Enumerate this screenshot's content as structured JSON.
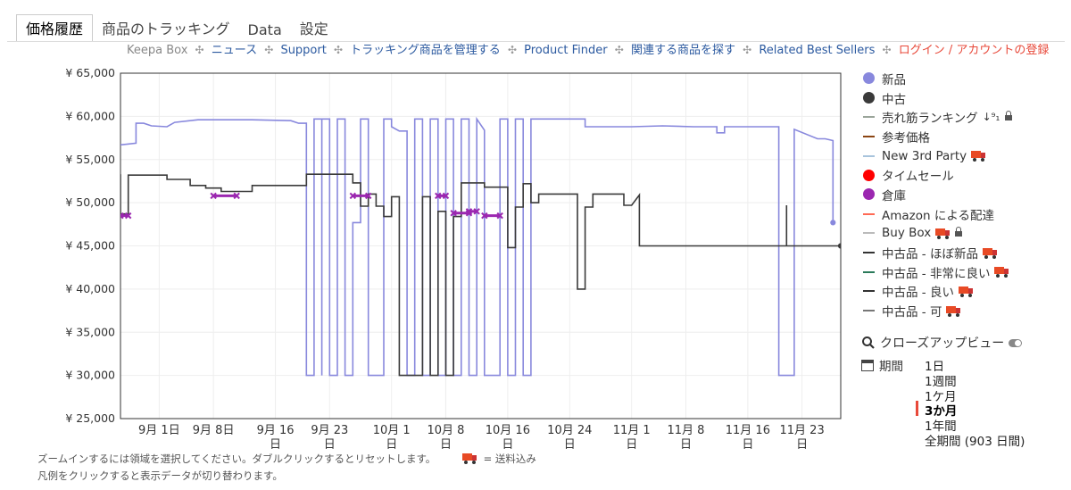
{
  "tabs": [
    {
      "label": "価格履歴",
      "active": true
    },
    {
      "label": "商品のトラッキング",
      "active": false
    },
    {
      "label": "Data",
      "active": false
    },
    {
      "label": "設定",
      "active": false
    }
  ],
  "links": {
    "keepa_box": "Keepa Box",
    "separator": "✣",
    "items": [
      "ニュース",
      "Support",
      "トラッキング商品を管理する",
      "Product Finder",
      "関連する商品を探す",
      "Related Best Sellers"
    ],
    "login": "ログイン / アカウントの登録"
  },
  "colors": {
    "new": "#8888dd",
    "used": "#3a3a3a",
    "warehouse": "#9b27b0",
    "lightning": "#ff0000",
    "amazon": "#ff6a55",
    "list": "#8b4513",
    "third": "#a8c4dc",
    "buybox": "#bbbbbb",
    "very_good": "#2a7a5a",
    "grid": "#eeeeee"
  },
  "legend": [
    {
      "label": "新品",
      "kind": "dot",
      "color": "#8888dd"
    },
    {
      "label": "中古",
      "kind": "dot",
      "color": "#3a3a3a"
    },
    {
      "label": "売れ筋ランキング",
      "kind": "dash",
      "color": "#9aa59a",
      "sort_icon": "↓⁹₁",
      "lock": true
    },
    {
      "label": "参考価格",
      "kind": "dash",
      "color": "#8b4513"
    },
    {
      "label": "New 3rd Party",
      "kind": "dash",
      "color": "#a8c4dc",
      "truck": true
    },
    {
      "label": "タイムセール",
      "kind": "dot",
      "color": "#ff0000"
    },
    {
      "label": "倉庫",
      "kind": "dot",
      "color": "#9b27b0"
    },
    {
      "label": "Amazon による配達",
      "kind": "dash",
      "color": "#ff6a55"
    },
    {
      "label": "Buy Box",
      "kind": "dash",
      "color": "#bbbbbb",
      "truck": true,
      "lock": true
    },
    {
      "label": "中古品 - ほぼ新品",
      "kind": "dash",
      "color": "#333333",
      "truck": true
    },
    {
      "label": "中古品 - 非常に良い",
      "kind": "dash",
      "color": "#2a7a5a",
      "truck": true
    },
    {
      "label": "中古品 - 良い",
      "kind": "dash",
      "color": "#333333",
      "truck": true
    },
    {
      "label": "中古品 - 可",
      "kind": "dash",
      "color": "#777777",
      "truck": true
    }
  ],
  "zoom": {
    "label": "クローズアップビュー"
  },
  "period": {
    "label": "期間",
    "options": [
      "1日",
      "1週間",
      "1ケ月",
      "3か月",
      "1年間",
      "全期間 (903 日間)"
    ],
    "selected": "3か月"
  },
  "footer": {
    "line1": "ズームインするには領域を選択してください。ダブルクリックするとリセットします。",
    "truck_note": "= 送料込み",
    "line2": "凡例をクリックすると表示データが切り替わります。"
  },
  "chart_data": {
    "type": "line",
    "x_unit": "date",
    "y_unit": "JPY",
    "xlim": [
      "2024-08-27",
      "2024-11-28"
    ],
    "ylim": [
      25000,
      65000
    ],
    "y_ticks": [
      25000,
      30000,
      35000,
      40000,
      45000,
      50000,
      55000,
      60000,
      65000
    ],
    "y_tick_labels": [
      "¥ 25,000",
      "¥ 30,000",
      "¥ 35,000",
      "¥ 40,000",
      "¥ 45,000",
      "¥ 50,000",
      "¥ 55,000",
      "¥ 60,000",
      "¥ 65,000"
    ],
    "x_ticks": [
      {
        "date": "2024-09-01",
        "l1": "9月 1日",
        "l2": ""
      },
      {
        "date": "2024-09-08",
        "l1": "9月 8日",
        "l2": ""
      },
      {
        "date": "2024-09-16",
        "l1": "9月 16",
        "l2": "日"
      },
      {
        "date": "2024-09-23",
        "l1": "9月 23",
        "l2": "日"
      },
      {
        "date": "2024-10-01",
        "l1": "10月 1",
        "l2": "日"
      },
      {
        "date": "2024-10-08",
        "l1": "10月 8",
        "l2": "日"
      },
      {
        "date": "2024-10-16",
        "l1": "10月 16",
        "l2": "日"
      },
      {
        "date": "2024-10-24",
        "l1": "10月 24",
        "l2": "日"
      },
      {
        "date": "2024-11-01",
        "l1": "11月 1",
        "l2": "日"
      },
      {
        "date": "2024-11-08",
        "l1": "11月 8",
        "l2": "日"
      },
      {
        "date": "2024-11-16",
        "l1": "11月 16",
        "l2": "日"
      },
      {
        "date": "2024-11-23",
        "l1": "11月 23",
        "l2": "日"
      }
    ],
    "grid": true,
    "legend_position": "right",
    "series": [
      {
        "name": "新品",
        "color": "#8888dd",
        "points": [
          [
            "2024-08-27",
            56700
          ],
          [
            "2024-08-29",
            56900
          ],
          [
            "2024-08-29",
            59200
          ],
          [
            "2024-08-30",
            59200
          ],
          [
            "2024-08-31",
            58900
          ],
          [
            "2024-09-02",
            58800
          ],
          [
            "2024-09-03",
            59300
          ],
          [
            "2024-09-06",
            59600
          ],
          [
            "2024-09-13",
            59600
          ],
          [
            "2024-09-18",
            59500
          ],
          [
            "2024-09-19",
            59200
          ],
          [
            "2024-09-20",
            59200
          ],
          [
            "2024-09-20",
            30000
          ],
          [
            "2024-09-21",
            30000
          ],
          [
            "2024-09-21",
            59700
          ],
          [
            "2024-09-22",
            59700
          ],
          [
            "2024-09-22",
            30000
          ],
          [
            "2024-09-22",
            59700
          ],
          [
            "2024-09-23",
            59700
          ],
          [
            "2024-09-23",
            30000
          ],
          [
            "2024-09-24",
            30000
          ],
          [
            "2024-09-24",
            59700
          ],
          [
            "2024-09-25",
            59700
          ],
          [
            "2024-09-25",
            30000
          ],
          [
            "2024-09-26",
            30000
          ],
          [
            "2024-09-26",
            47700
          ],
          [
            "2024-09-27",
            47700
          ],
          [
            "2024-09-27",
            59700
          ],
          [
            "2024-09-28",
            59700
          ],
          [
            "2024-09-28",
            30000
          ],
          [
            "2024-09-30",
            30000
          ],
          [
            "2024-09-30",
            59700
          ],
          [
            "2024-10-01",
            59700
          ],
          [
            "2024-10-01",
            58800
          ],
          [
            "2024-10-02",
            58300
          ],
          [
            "2024-10-03",
            58300
          ],
          [
            "2024-10-03",
            30000
          ],
          [
            "2024-10-04",
            30000
          ],
          [
            "2024-10-04",
            59700
          ],
          [
            "2024-10-05",
            59700
          ],
          [
            "2024-10-05",
            30000
          ],
          [
            "2024-10-06",
            30000
          ],
          [
            "2024-10-06",
            59700
          ],
          [
            "2024-10-07",
            59700
          ],
          [
            "2024-10-07",
            30000
          ],
          [
            "2024-10-08",
            30000
          ],
          [
            "2024-10-08",
            59700
          ],
          [
            "2024-10-09",
            59700
          ],
          [
            "2024-10-09",
            30000
          ],
          [
            "2024-10-10",
            30000
          ],
          [
            "2024-10-10",
            59700
          ],
          [
            "2024-10-11",
            59700
          ],
          [
            "2024-10-11",
            30000
          ],
          [
            "2024-10-12",
            30000
          ],
          [
            "2024-10-12",
            59700
          ],
          [
            "2024-10-13",
            58400
          ],
          [
            "2024-10-13",
            30000
          ],
          [
            "2024-10-15",
            30000
          ],
          [
            "2024-10-15",
            59700
          ],
          [
            "2024-10-16",
            59700
          ],
          [
            "2024-10-16",
            30000
          ],
          [
            "2024-10-17",
            30000
          ],
          [
            "2024-10-17",
            59700
          ],
          [
            "2024-10-18",
            59700
          ],
          [
            "2024-10-18",
            30000
          ],
          [
            "2024-10-19",
            30000
          ],
          [
            "2024-10-19",
            59700
          ],
          [
            "2024-10-26",
            59700
          ],
          [
            "2024-10-26",
            58800
          ],
          [
            "2024-10-31",
            58800
          ],
          [
            "2024-11-01",
            58800
          ],
          [
            "2024-11-05",
            58900
          ],
          [
            "2024-11-09",
            58800
          ],
          [
            "2024-11-12",
            58800
          ],
          [
            "2024-11-12",
            58100
          ],
          [
            "2024-11-13",
            58100
          ],
          [
            "2024-11-13",
            58800
          ],
          [
            "2024-11-20",
            58800
          ],
          [
            "2024-11-20",
            30000
          ],
          [
            "2024-11-22",
            30000
          ],
          [
            "2024-11-22",
            58500
          ],
          [
            "2024-11-25",
            57400
          ],
          [
            "2024-11-26",
            57400
          ],
          [
            "2024-11-27",
            57200
          ],
          [
            "2024-11-27",
            47700
          ]
        ]
      },
      {
        "name": "中古",
        "color": "#3a3a3a",
        "points": [
          [
            "2024-08-27",
            53300
          ],
          [
            "2024-08-27",
            48700
          ],
          [
            "2024-08-28",
            48700
          ],
          [
            "2024-08-28",
            53200
          ],
          [
            "2024-09-02",
            53200
          ],
          [
            "2024-09-02",
            52700
          ],
          [
            "2024-09-05",
            52700
          ],
          [
            "2024-09-05",
            52000
          ],
          [
            "2024-09-07",
            52000
          ],
          [
            "2024-09-07",
            51700
          ],
          [
            "2024-09-09",
            51700
          ],
          [
            "2024-09-09",
            51300
          ],
          [
            "2024-09-13",
            51300
          ],
          [
            "2024-09-13",
            52000
          ],
          [
            "2024-09-20",
            52000
          ],
          [
            "2024-09-20",
            53300
          ],
          [
            "2024-09-26",
            53300
          ],
          [
            "2024-09-26",
            52300
          ],
          [
            "2024-09-27",
            52300
          ],
          [
            "2024-09-27",
            49600
          ],
          [
            "2024-09-28",
            49600
          ],
          [
            "2024-09-28",
            51000
          ],
          [
            "2024-09-29",
            51000
          ],
          [
            "2024-09-29",
            49600
          ],
          [
            "2024-09-30",
            49600
          ],
          [
            "2024-09-30",
            48400
          ],
          [
            "2024-10-01",
            48400
          ],
          [
            "2024-10-01",
            50700
          ],
          [
            "2024-10-02",
            50700
          ],
          [
            "2024-10-02",
            30000
          ],
          [
            "2024-10-05",
            30000
          ],
          [
            "2024-10-05",
            50700
          ],
          [
            "2024-10-06",
            50700
          ],
          [
            "2024-10-06",
            30000
          ],
          [
            "2024-10-07",
            30000
          ],
          [
            "2024-10-07",
            49000
          ],
          [
            "2024-10-08",
            49000
          ],
          [
            "2024-10-08",
            30000
          ],
          [
            "2024-10-09",
            30000
          ],
          [
            "2024-10-09",
            48400
          ],
          [
            "2024-10-10",
            48400
          ],
          [
            "2024-10-10",
            52300
          ],
          [
            "2024-10-13",
            52300
          ],
          [
            "2024-10-13",
            51800
          ],
          [
            "2024-10-16",
            51800
          ],
          [
            "2024-10-16",
            44800
          ],
          [
            "2024-10-17",
            44800
          ],
          [
            "2024-10-17",
            49500
          ],
          [
            "2024-10-18",
            49500
          ],
          [
            "2024-10-18",
            52200
          ],
          [
            "2024-10-19",
            52200
          ],
          [
            "2024-10-19",
            50000
          ],
          [
            "2024-10-20",
            50000
          ],
          [
            "2024-10-20",
            51000
          ],
          [
            "2024-10-25",
            51000
          ],
          [
            "2024-10-25",
            40000
          ],
          [
            "2024-10-26",
            40000
          ],
          [
            "2024-10-26",
            49500
          ],
          [
            "2024-10-27",
            49500
          ],
          [
            "2024-10-27",
            51000
          ],
          [
            "2024-10-31",
            51000
          ],
          [
            "2024-10-31",
            49700
          ],
          [
            "2024-11-01",
            49700
          ],
          [
            "2024-11-02",
            50900
          ],
          [
            "2024-11-02",
            45000
          ],
          [
            "2024-11-21",
            45000
          ],
          [
            "2024-11-21",
            49700
          ],
          [
            "2024-11-21",
            45000
          ],
          [
            "2024-11-28",
            45000
          ]
        ]
      },
      {
        "name": "倉庫",
        "color": "#9b27b0",
        "segments": [
          [
            [
              "2024-08-27",
              48500
            ],
            [
              "2024-08-28",
              48500
            ]
          ],
          [
            [
              "2024-09-08",
              50800
            ],
            [
              "2024-09-11",
              50800
            ]
          ],
          [
            [
              "2024-09-26",
              50800
            ],
            [
              "2024-09-28",
              50800
            ]
          ],
          [
            [
              "2024-10-07",
              50800
            ],
            [
              "2024-10-08",
              50800
            ]
          ],
          [
            [
              "2024-10-09",
              48800
            ],
            [
              "2024-10-11",
              48800
            ]
          ],
          [
            [
              "2024-10-11",
              49000
            ],
            [
              "2024-10-12",
              49000
            ]
          ],
          [
            [
              "2024-10-13",
              48500
            ],
            [
              "2024-10-15",
              48500
            ]
          ]
        ]
      }
    ]
  }
}
